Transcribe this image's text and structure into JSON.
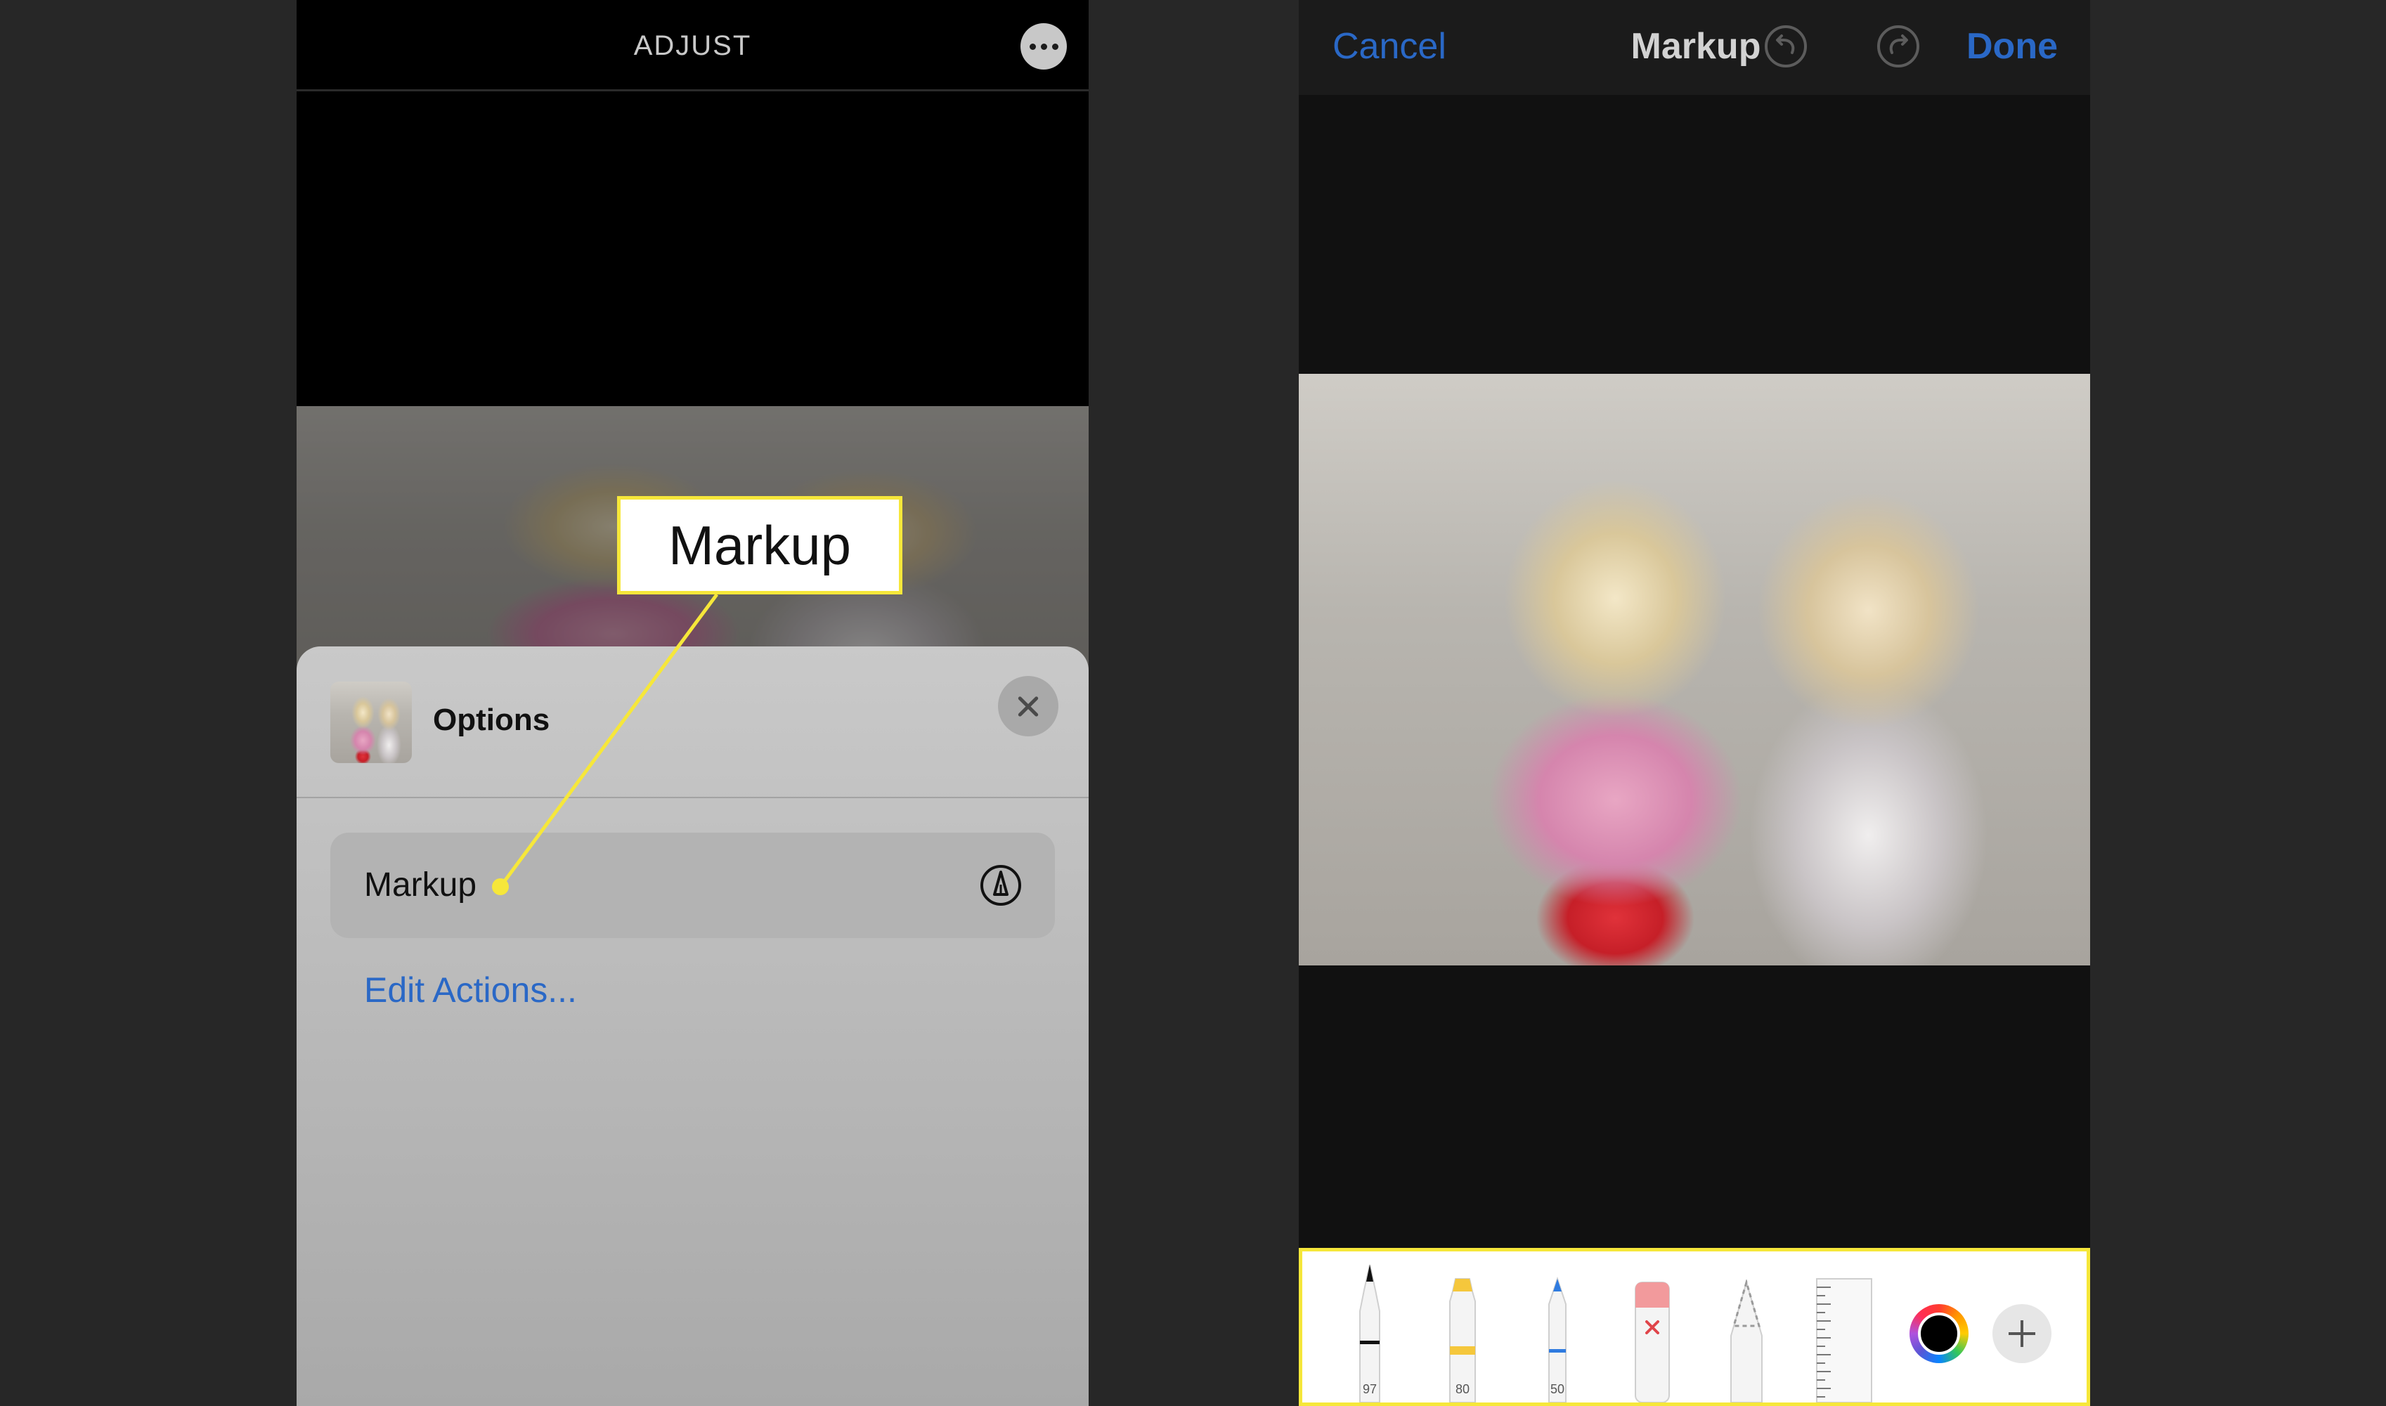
{
  "left_screen": {
    "header_title": "ADJUST",
    "options_sheet": {
      "title": "Options",
      "markup_item_label": "Markup",
      "edit_actions_label": "Edit Actions..."
    },
    "callout_label": "Markup"
  },
  "right_screen": {
    "nav": {
      "cancel_label": "Cancel",
      "title": "Markup",
      "done_label": "Done"
    },
    "tools": [
      {
        "name": "pen",
        "size": "97"
      },
      {
        "name": "highlighter",
        "size": "80"
      },
      {
        "name": "pencil",
        "size": "50"
      },
      {
        "name": "eraser"
      },
      {
        "name": "lasso"
      },
      {
        "name": "ruler"
      }
    ],
    "selected_color": "#000000"
  },
  "colors": {
    "accent_blue": "#2a68c6",
    "callout_yellow": "#f6e73a"
  }
}
